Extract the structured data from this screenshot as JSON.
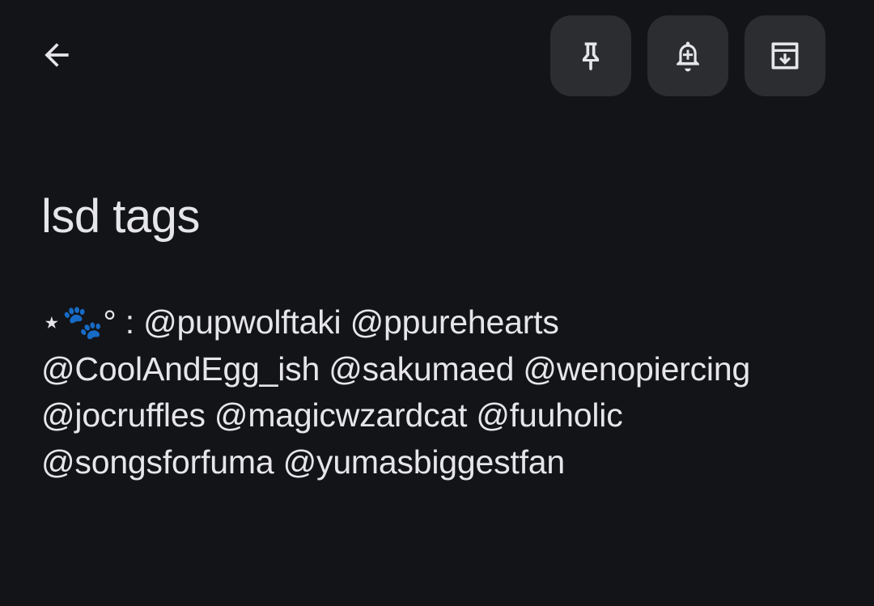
{
  "note": {
    "title": "lsd tags",
    "body_lines": [
      "⋆🐾° : @pupwolftaki @ppurehearts",
      "@CoolAndEgg_ish @sakumaed @wenopiercing",
      "@jocruffles @magicwzardcat @fuuholic",
      "@songsforfuma @yumasbiggestfan"
    ]
  },
  "toolbar": {
    "back_icon": "arrow-back-icon",
    "pin_icon": "pin-icon",
    "reminder_icon": "bell-plus-icon",
    "archive_icon": "archive-icon"
  },
  "colors": {
    "background": "#131418",
    "button_background": "#2b2d31",
    "text": "#e6e6ea"
  }
}
